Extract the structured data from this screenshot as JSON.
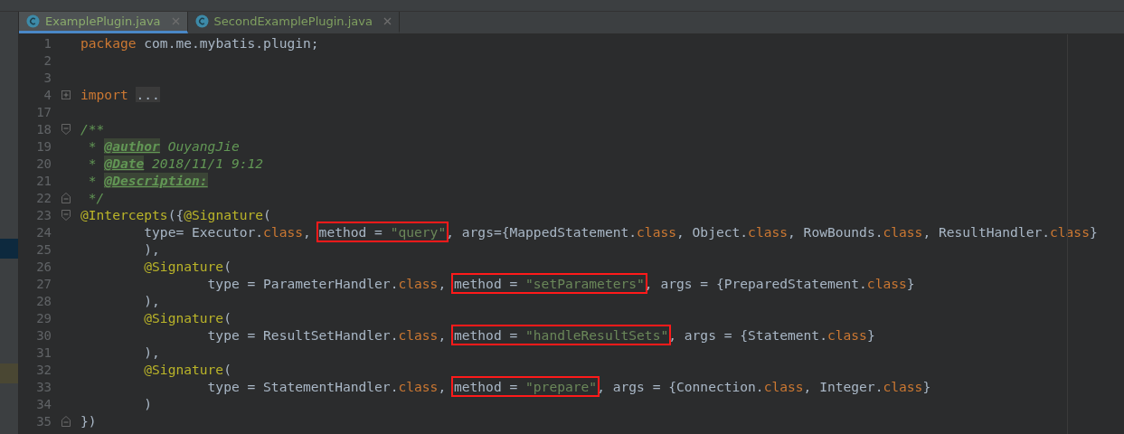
{
  "tabs": [
    {
      "label": "ExamplePlugin.java",
      "selected": true
    },
    {
      "label": "SecondExamplePlugin.java",
      "selected": false
    }
  ],
  "lines": [
    {
      "number": "1",
      "kind": "plain",
      "tokens": [
        {
          "kind": "keyword",
          "text": "package"
        },
        {
          "kind": "plain",
          "text": " com.me.mybatis.plugin;"
        }
      ]
    },
    {
      "number": "2",
      "kind": "plain"
    },
    {
      "number": "3",
      "kind": "plain"
    },
    {
      "number": "4",
      "kind": "fold_expand",
      "tokens": [
        {
          "kind": "keyword",
          "text": "import"
        },
        {
          "kind": "folded",
          "text": "..."
        }
      ]
    },
    {
      "number": "17",
      "kind": "plain"
    },
    {
      "number": "18",
      "kind": "fold_start",
      "tokens": [
        {
          "kind": "comment",
          "text": "/**"
        }
      ]
    },
    {
      "number": "19",
      "kind": "plain",
      "tokens": [
        {
          "kind": "comment",
          "text": " * "
        },
        {
          "kind": "doctag",
          "text": "@author"
        },
        {
          "kind": "comment",
          "text": " OuyangJie"
        }
      ]
    },
    {
      "number": "20",
      "kind": "plain",
      "tokens": [
        {
          "kind": "comment",
          "text": " * "
        },
        {
          "kind": "doctag",
          "text": "@Date"
        },
        {
          "kind": "comment",
          "text": " 2018/11/1 9:12"
        }
      ]
    },
    {
      "number": "21",
      "kind": "plain",
      "tokens": [
        {
          "kind": "comment",
          "text": " * "
        },
        {
          "kind": "doctag",
          "text": "@Description:"
        }
      ]
    },
    {
      "number": "22",
      "kind": "fold_end",
      "tokens": [
        {
          "kind": "comment",
          "text": " */"
        }
      ]
    },
    {
      "number": "23",
      "kind": "fold_start",
      "tokens": [
        {
          "kind": "annotation",
          "text": "@Intercepts"
        },
        {
          "kind": "plain",
          "text": "({"
        },
        {
          "kind": "annotation",
          "text": "@Signature"
        },
        {
          "kind": "plain",
          "text": "("
        }
      ]
    },
    {
      "number": "24",
      "kind": "plain",
      "tokens": [
        {
          "kind": "plain",
          "text": "        type= Executor."
        },
        {
          "kind": "keyword",
          "text": "class"
        },
        {
          "kind": "plain",
          "text": ", "
        },
        {
          "kind": "highlight",
          "tokens": [
            {
              "kind": "plain",
              "text": "method = "
            },
            {
              "kind": "string",
              "text": "\"query\""
            }
          ]
        },
        {
          "kind": "plain",
          "text": ", args={MappedStatement."
        },
        {
          "kind": "keyword",
          "text": "class"
        },
        {
          "kind": "plain",
          "text": ", Object."
        },
        {
          "kind": "keyword",
          "text": "class"
        },
        {
          "kind": "plain",
          "text": ", RowBounds."
        },
        {
          "kind": "keyword",
          "text": "class"
        },
        {
          "kind": "plain",
          "text": ", ResultHandler."
        },
        {
          "kind": "keyword",
          "text": "class"
        },
        {
          "kind": "plain",
          "text": "}"
        }
      ]
    },
    {
      "number": "25",
      "kind": "plain",
      "tokens": [
        {
          "kind": "plain",
          "text": "        ),"
        }
      ]
    },
    {
      "number": "26",
      "kind": "plain",
      "tokens": [
        {
          "kind": "annotation",
          "text": "        @Signature"
        },
        {
          "kind": "plain",
          "text": "("
        }
      ]
    },
    {
      "number": "27",
      "kind": "plain",
      "tokens": [
        {
          "kind": "plain",
          "text": "                type = ParameterHandler."
        },
        {
          "kind": "keyword",
          "text": "class"
        },
        {
          "kind": "plain",
          "text": ", "
        },
        {
          "kind": "highlight",
          "tokens": [
            {
              "kind": "plain",
              "text": "method = "
            },
            {
              "kind": "string",
              "text": "\"setParameters\""
            }
          ]
        },
        {
          "kind": "plain",
          "text": ", args = {PreparedStatement."
        },
        {
          "kind": "keyword",
          "text": "class"
        },
        {
          "kind": "plain",
          "text": "}"
        }
      ]
    },
    {
      "number": "28",
      "kind": "plain",
      "tokens": [
        {
          "kind": "plain",
          "text": "        ),"
        }
      ]
    },
    {
      "number": "29",
      "kind": "plain",
      "tokens": [
        {
          "kind": "annotation",
          "text": "        @Signature"
        },
        {
          "kind": "plain",
          "text": "("
        }
      ]
    },
    {
      "number": "30",
      "kind": "plain",
      "tokens": [
        {
          "kind": "plain",
          "text": "                type = ResultSetHandler."
        },
        {
          "kind": "keyword",
          "text": "class"
        },
        {
          "kind": "plain",
          "text": ", "
        },
        {
          "kind": "highlight",
          "tokens": [
            {
              "kind": "plain",
              "text": "method = "
            },
            {
              "kind": "string",
              "text": "\"handleResultSets\""
            }
          ]
        },
        {
          "kind": "plain",
          "text": ", args = {Statement."
        },
        {
          "kind": "keyword",
          "text": "class"
        },
        {
          "kind": "plain",
          "text": "}"
        }
      ]
    },
    {
      "number": "31",
      "kind": "plain",
      "tokens": [
        {
          "kind": "plain",
          "text": "        ),"
        }
      ]
    },
    {
      "number": "32",
      "kind": "plain",
      "tokens": [
        {
          "kind": "annotation",
          "text": "        @Signature"
        },
        {
          "kind": "plain",
          "text": "("
        }
      ]
    },
    {
      "number": "33",
      "kind": "plain",
      "tokens": [
        {
          "kind": "plain",
          "text": "                type = StatementHandler."
        },
        {
          "kind": "keyword",
          "text": "class"
        },
        {
          "kind": "plain",
          "text": ", "
        },
        {
          "kind": "highlight",
          "tokens": [
            {
              "kind": "plain",
              "text": "method = "
            },
            {
              "kind": "string",
              "text": "\"prepare\""
            }
          ]
        },
        {
          "kind": "plain",
          "text": ", args = {Connection."
        },
        {
          "kind": "keyword",
          "text": "class"
        },
        {
          "kind": "plain",
          "text": ", Integer."
        },
        {
          "kind": "keyword",
          "text": "class"
        },
        {
          "kind": "plain",
          "text": "}"
        }
      ]
    },
    {
      "number": "34",
      "kind": "plain",
      "tokens": [
        {
          "kind": "plain",
          "text": "        )"
        }
      ]
    },
    {
      "number": "35",
      "kind": "fold_end",
      "tokens": [
        {
          "kind": "plain",
          "text": "})"
        }
      ]
    }
  ]
}
